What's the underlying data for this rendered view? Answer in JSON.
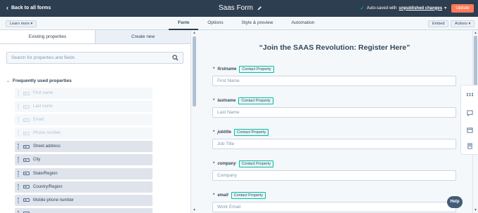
{
  "topbar": {
    "back_label": "Back to all forms",
    "form_title": "Saas Form",
    "autosave_prefix": "Auto-saved with",
    "autosave_link": "unpublished changes",
    "update_label": "Update"
  },
  "toolbar": {
    "learn_more": "Learn more ▾",
    "tabs": [
      {
        "label": "Form"
      },
      {
        "label": "Options"
      },
      {
        "label": "Style & preview"
      },
      {
        "label": "Automation"
      }
    ],
    "embed_label": "Embed",
    "actions_label": "Actions ▾"
  },
  "left_panel": {
    "tabs": [
      {
        "label": "Existing properties"
      },
      {
        "label": "Create new"
      }
    ],
    "search_placeholder": "Search for properties and fields",
    "section_title": "Frequently used properties",
    "properties": [
      {
        "label": "First name",
        "enabled": false
      },
      {
        "label": "Last name",
        "enabled": false
      },
      {
        "label": "Email",
        "enabled": false
      },
      {
        "label": "Phone number",
        "enabled": false
      },
      {
        "label": "Street address",
        "enabled": true
      },
      {
        "label": "City",
        "enabled": true
      },
      {
        "label": "State/Region",
        "enabled": true
      },
      {
        "label": "Country/Region",
        "enabled": true
      },
      {
        "label": "Mobile phone number",
        "enabled": true
      },
      {
        "label": "",
        "enabled": true
      }
    ]
  },
  "preview": {
    "title": "“Join the SAAS Revolution: Register Here”",
    "fields": [
      {
        "name": "firstname",
        "badge": "Contact Property",
        "placeholder": "First Name"
      },
      {
        "name": "lastname",
        "badge": "Contact Property",
        "placeholder": "Last Name"
      },
      {
        "name": "jobtitle",
        "badge": "Contact Property",
        "placeholder": "Job Title"
      },
      {
        "name": "company",
        "badge": "Contact Property",
        "placeholder": "Company"
      },
      {
        "name": "email",
        "badge": "Contact Property",
        "placeholder": "Work Email"
      }
    ],
    "required_marker": "*"
  },
  "help_label": "Help",
  "icons": [
    "chevron-left-icon",
    "pencil-icon",
    "check-icon",
    "search-icon",
    "grip-icon",
    "field-icon",
    "grid-icon",
    "chat-icon",
    "calendar-icon",
    "book-icon"
  ]
}
